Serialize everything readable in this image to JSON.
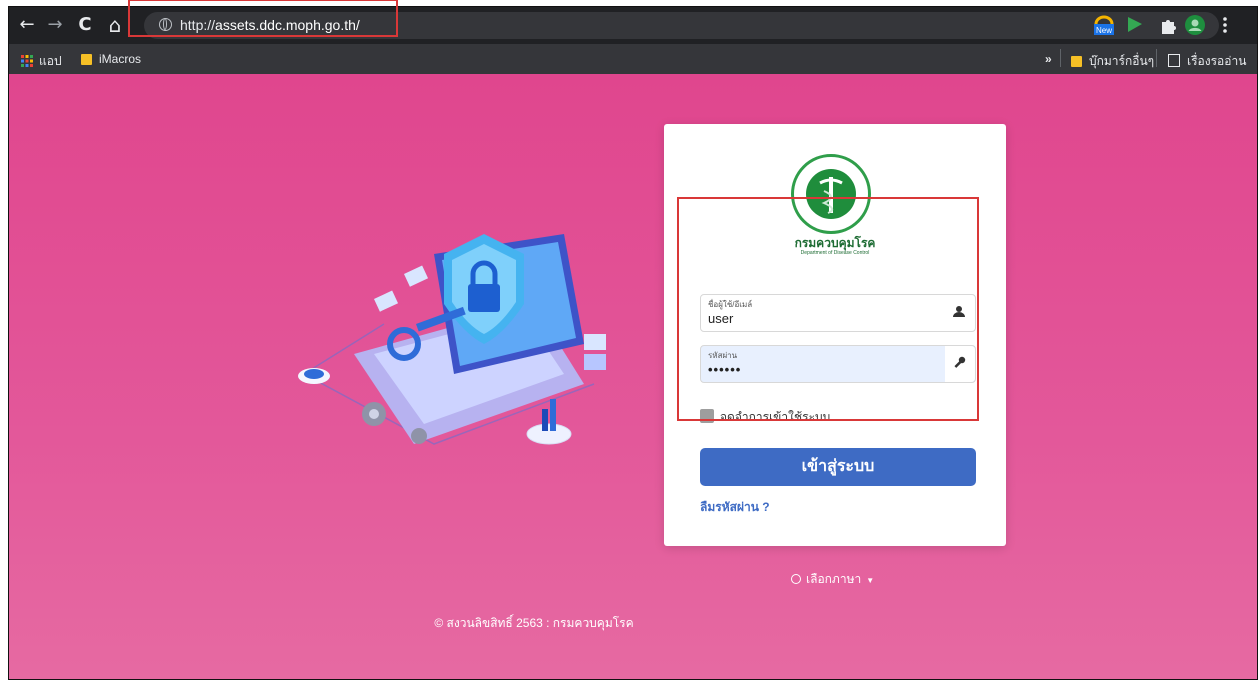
{
  "browser": {
    "url_scheme": "http://",
    "url_host": "assets.ddc.moph.go.th/",
    "nav": {
      "back": "←",
      "forward": "→",
      "reload": "C",
      "home": "⌂"
    },
    "extensions": [
      "new-badge-extension",
      "green-flag-extension",
      "puzzle-extension",
      "profile-avatar",
      "menu-kebab"
    ],
    "new_badge": "New"
  },
  "bookmarks": {
    "apps": "แอป",
    "imacros": "iMacros",
    "overflow": "»",
    "other": "บุ๊กมาร์กอื่นๆ",
    "reading_list": "เรื่องรออ่าน"
  },
  "login": {
    "org_name": "กรมควบคุมโรค",
    "org_sub": "Department of Disease Control",
    "username_label": "ชื่อผู้ใช้/อีเมล์",
    "username_value": "user",
    "password_label": "รหัสผ่าน",
    "password_value": "••••••",
    "remember_label": "จดจำการเข้าใช้ระบบ",
    "submit_label": "เข้าสู่ระบบ",
    "forgot_label": "ลืมรหัสผ่าน ?",
    "language_label": "เลือกภาษา",
    "footer": "© สงวนลิขสิทธิ์ 2563 : กรมควบคุมโรค"
  },
  "colors": {
    "page_bg": "#e0468e",
    "primary": "#3e6bc4",
    "annotation": "#d93838"
  }
}
